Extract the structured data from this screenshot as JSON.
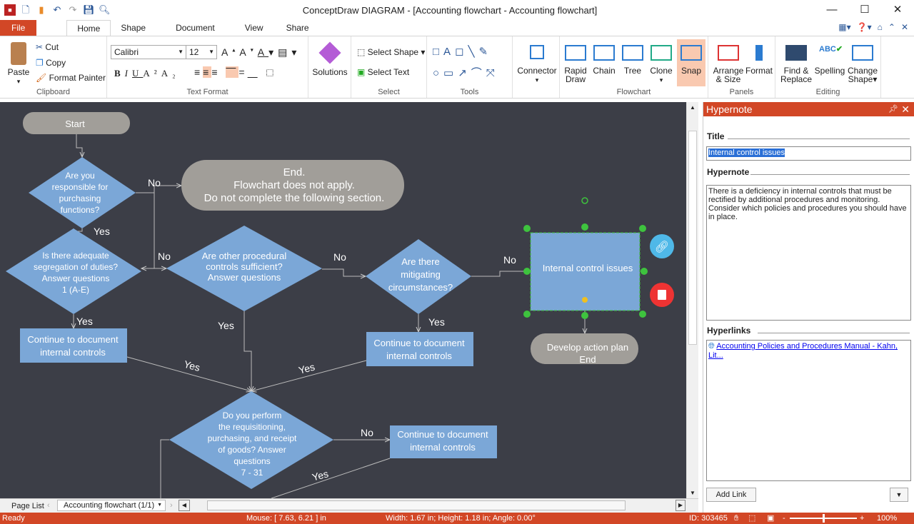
{
  "window": {
    "title": "ConceptDraw DIAGRAM - [Accounting flowchart - Accounting flowchart]"
  },
  "tabs": [
    "File",
    "Home",
    "Shape",
    "Document",
    "View",
    "Share"
  ],
  "ribbon": {
    "clipboard": {
      "paste": "Paste",
      "cut": "Cut",
      "copy": "Copy",
      "format_painter": "Format Painter",
      "label": "Clipboard"
    },
    "text_format": {
      "font": "Calibri",
      "size": "12",
      "label": "Text Format"
    },
    "solutions": "Solutions",
    "select": {
      "select_shape": "Select Shape",
      "select_text": "Select Text",
      "label": "Select"
    },
    "tools": {
      "label": "Tools"
    },
    "flowchart": {
      "connector": "Connector",
      "rapid_draw": [
        "Rapid",
        "Draw"
      ],
      "chain": "Chain",
      "tree": "Tree",
      "clone": "Clone",
      "snap": "Snap",
      "label": "Flowchart"
    },
    "panels": {
      "arrange": [
        "Arrange",
        "& Size"
      ],
      "format": "Format",
      "label": "Panels"
    },
    "editing": {
      "find": [
        "Find &",
        "Replace"
      ],
      "spelling": "Spelling",
      "change_shape": [
        "Change",
        "Shape"
      ],
      "label": "Editing"
    }
  },
  "flowchart": {
    "start": "Start",
    "q1": [
      "Are you",
      "responsible for",
      "purchasing",
      "functions?"
    ],
    "end1": [
      "End.",
      "Flowchart does not apply.",
      "Do not complete the following section."
    ],
    "q2": [
      "Is there adequate",
      "segregation of duties?",
      "Answer questions",
      "1 (A-E)"
    ],
    "q3": [
      "Are other procedural",
      "controls sufficient?",
      "Answer questions"
    ],
    "q4": [
      "Are there",
      "mitigating",
      "circumstances?"
    ],
    "internal": "Internal control issues",
    "develop": [
      "Develop action plan",
      "End"
    ],
    "cont1": [
      "Continue to document",
      "internal controls"
    ],
    "cont2": [
      "Continue to document",
      "internal controls"
    ],
    "cont3": [
      "Continue to document",
      "internal controls"
    ],
    "q5": [
      "Do you perform",
      "the requisitioning,",
      "purchasing, and receipt",
      "of goods? Answer",
      "questions",
      "7 - 31"
    ],
    "labels": {
      "no": "No",
      "yes": "Yes"
    }
  },
  "hypernote": {
    "header": "Hypernote",
    "title_label": "Title",
    "title_value": "Internal control issues",
    "note_label": "Hypernote",
    "note_text": "There is a deficiency in internal controls that must be rectified by additional procedures and monitoring.\nConsider which policies and procedures you should have in place.",
    "links_label": "Hyperlinks",
    "link": "Accounting Policies and Procedures Manual - Kahn, Lit...",
    "add_link": "Add Link"
  },
  "pages": {
    "page_list": "Page List",
    "current": "Accounting flowchart (1/1)"
  },
  "status": {
    "ready": "Ready",
    "mouse": "Mouse: [ 7.63, 6.21 ] in",
    "size": "Width: 1.67 in;  Height: 1.18 in;  Angle: 0.00°",
    "id": "ID: 303465",
    "zoom": "100%",
    "zoom_level": 100
  },
  "colors": {
    "accent": "#d24726",
    "shape": "#7ba7d7",
    "terminator": "#a19e99",
    "canvas": "#3c3e47",
    "selection": "#3ec33e"
  }
}
